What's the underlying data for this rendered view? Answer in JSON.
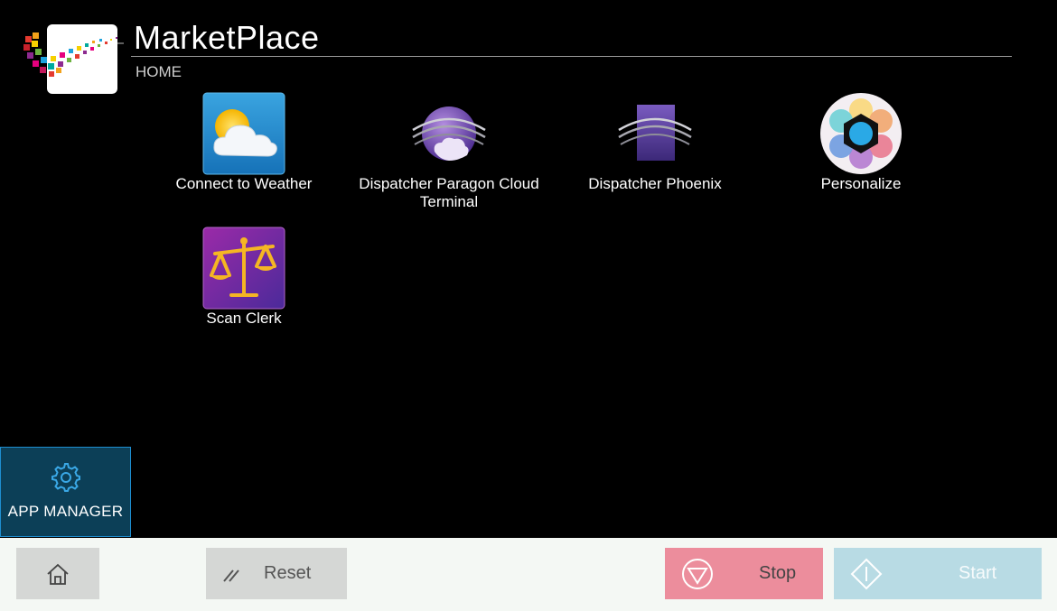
{
  "header": {
    "title": "MarketPlace",
    "breadcrumb": "HOME"
  },
  "apps": [
    {
      "label": "Connect to Weather",
      "icon": "weather-cloud-sun-icon"
    },
    {
      "label": "Dispatcher Paragon Cloud Terminal",
      "icon": "dispatcher-paragon-globe-icon"
    },
    {
      "label": "Dispatcher Phoenix",
      "icon": "dispatcher-phoenix-icon"
    },
    {
      "label": "Personalize",
      "icon": "personalize-color-wheel-icon"
    },
    {
      "label": "Scan Clerk",
      "icon": "scan-clerk-scales-icon"
    }
  ],
  "sidebar": {
    "app_manager_label": "APP MANAGER"
  },
  "bottom_bar": {
    "reset_label": "Reset",
    "stop_label": "Stop",
    "start_label": "Start"
  },
  "colors": {
    "background": "#000000",
    "app_manager_bg": "#0c3f57",
    "app_manager_border": "#1e8ed0",
    "stop_button": "#ec8d9c",
    "start_button": "#b8dbe4",
    "neutral_button": "#d5d7d5",
    "bottom_bar": "#f4f8f4"
  }
}
